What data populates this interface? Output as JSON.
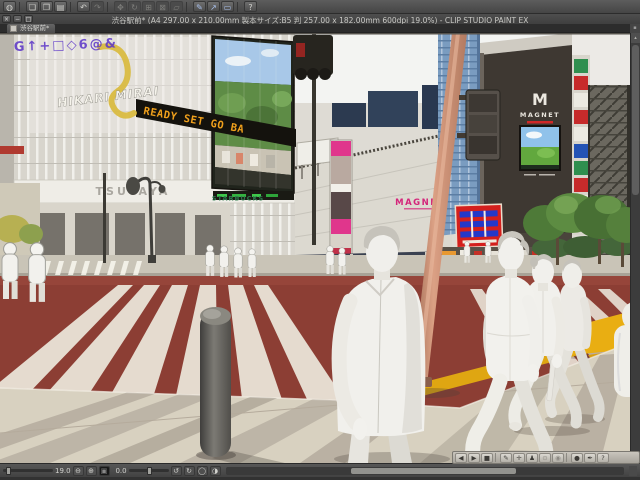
{
  "window": {
    "title": "渋谷駅前* (A4 297.00 x 210.00mm 製本サイズ:B5 判 257.00 x 182.00mm 600dpi 19.0%) - CLIP STUDIO PAINT EX",
    "buttons": [
      {
        "name": "close-button",
        "glyph": "×"
      },
      {
        "name": "minimize-button",
        "glyph": "−"
      },
      {
        "name": "restore-button",
        "glyph": "□"
      }
    ]
  },
  "main_toolbar": {
    "icons": [
      {
        "name": "clip-studio-logo-icon",
        "glyph": "◍"
      },
      {
        "sep": true
      },
      {
        "name": "new-file-icon",
        "glyph": "❏"
      },
      {
        "name": "open-file-icon",
        "glyph": "❒"
      },
      {
        "name": "save-file-icon",
        "glyph": "▤"
      },
      {
        "sep": true
      },
      {
        "name": "undo-icon",
        "glyph": "↶"
      },
      {
        "name": "redo-icon",
        "glyph": "↷",
        "dim": true
      },
      {
        "sep": true
      },
      {
        "name": "move-tool-icon",
        "glyph": "✥",
        "dim": true
      },
      {
        "name": "rotate-tool-icon",
        "glyph": "↻",
        "dim": true
      },
      {
        "name": "scale-tool-icon",
        "glyph": "⊞",
        "dim": true
      },
      {
        "name": "mesh-transform-icon",
        "glyph": "⊠",
        "dim": true
      },
      {
        "name": "selection-icon",
        "glyph": "▱",
        "dim": true
      },
      {
        "sep": true
      },
      {
        "name": "snap-ruler-icon",
        "glyph": "✎",
        "tint": true
      },
      {
        "name": "snap-curve-icon",
        "glyph": "↗",
        "tint": true
      },
      {
        "name": "snap-grid-icon",
        "glyph": "▭",
        "tint": true
      },
      {
        "sep": true
      },
      {
        "name": "help-icon",
        "glyph": "?"
      }
    ]
  },
  "tab_bar": {
    "active_tab": "渋谷駅前*"
  },
  "scene": {
    "signs": {
      "led_ticker": "READY SET GO BA",
      "tsutaya": "TSUTAYA",
      "starbucks": "STARBUCKS",
      "magnet_wall": "MAGNET",
      "magnet_tower_logo": "M",
      "magnet_tower_name": "MAGNET",
      "graffiti_text": "HIKARI MIRAI",
      "watermark": "G↑+□◇6@&"
    },
    "colors": {
      "road_red": "#8c3e34",
      "sidewalk_beige": "#d8d1c0",
      "tactile_yellow": "#dfa612",
      "pole_salmon": "#c98e74",
      "magnet_pink": "#d4257a",
      "billboard_red": "#d41f1c",
      "billboard_blue": "#2438c8",
      "screen_green": "#5e8c46",
      "led_orange": "#f0a01c",
      "starbucks_green": "#2e7d4f"
    }
  },
  "object_launcher": {
    "icons": [
      {
        "name": "prev-object-button",
        "glyph": "◀"
      },
      {
        "name": "next-object-button",
        "glyph": "▶"
      },
      {
        "name": "stop-button",
        "glyph": "■"
      },
      {
        "sep": true
      },
      {
        "name": "object-tool-button",
        "glyph": "✎"
      },
      {
        "name": "camera-move-button",
        "glyph": "✛"
      },
      {
        "name": "pose-button",
        "glyph": "♟"
      },
      {
        "name": "camera-orbit-button",
        "glyph": "⊙",
        "dim": true
      },
      {
        "name": "camera-pan-button",
        "glyph": "◉",
        "dim": true
      },
      {
        "sep": true
      },
      {
        "name": "material-sphere-button",
        "glyph": "●"
      },
      {
        "name": "pen-button",
        "glyph": "✒"
      },
      {
        "name": "launcher-options-button",
        "glyph": "?"
      }
    ]
  },
  "bottom_bar": {
    "zoom_value": "19.0",
    "rotation_value": "0.0",
    "zoom_icons": [
      {
        "name": "zoom-out-icon",
        "glyph": "⊖"
      },
      {
        "name": "zoom-in-icon",
        "glyph": "⊕"
      },
      {
        "name": "fit-screen-button",
        "glyph": "▣",
        "dark": true
      }
    ],
    "rotate_icons": [
      {
        "name": "rotate-ccw-icon",
        "glyph": "↺"
      },
      {
        "name": "rotate-cw-icon",
        "glyph": "↻"
      },
      {
        "name": "reset-rotation-icon",
        "glyph": "◯"
      },
      {
        "name": "flip-horizontal-icon",
        "glyph": "◑"
      }
    ]
  }
}
